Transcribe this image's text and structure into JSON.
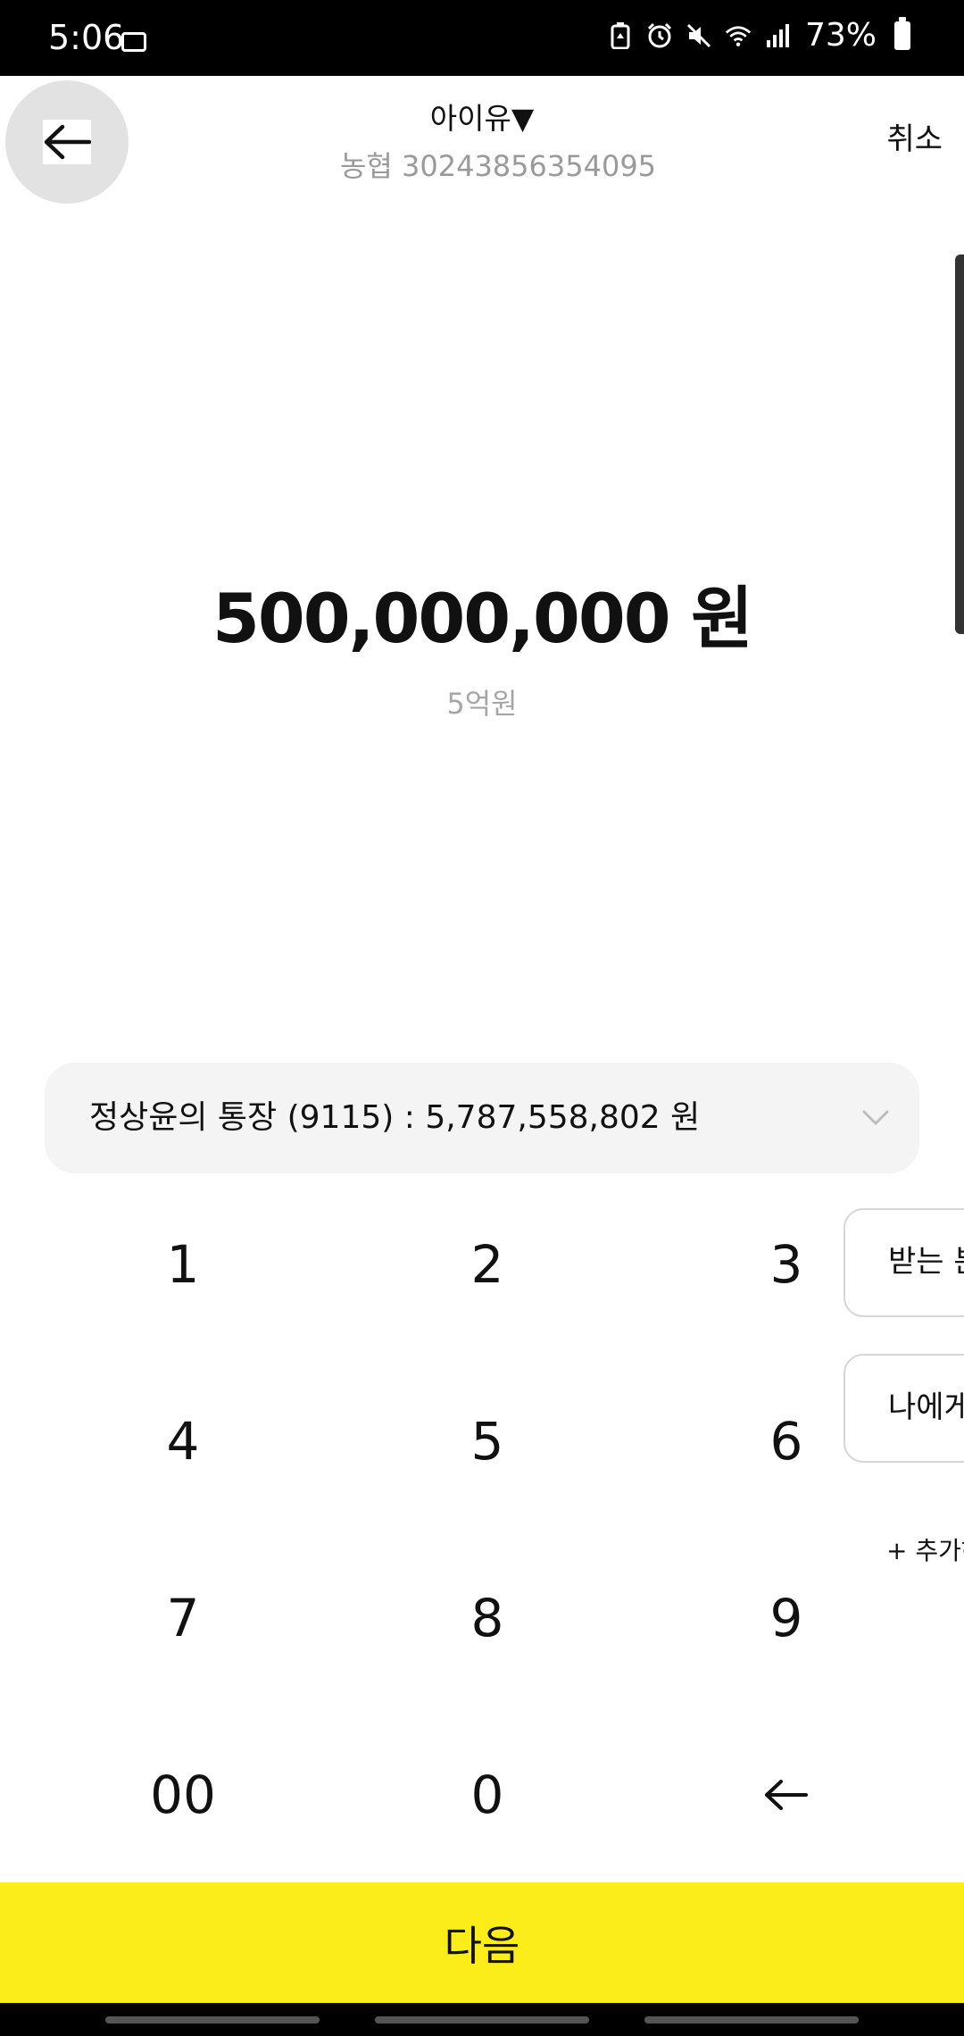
{
  "status_bar": {
    "time": "5:06",
    "battery_percent": "73%",
    "icons": [
      "screen-record-icon",
      "battery-saver-icon",
      "alarm-icon",
      "mute-icon",
      "wifi-icon",
      "signal-icon",
      "battery-icon"
    ]
  },
  "header": {
    "back_icon": "arrow-left-icon",
    "recipient_name": "아이유▼",
    "recipient_account": "농협 30243856354095",
    "cancel_label": "취소"
  },
  "amount": {
    "value": "500,000,000 원",
    "korean": "5억원"
  },
  "source_account": {
    "label": "정상윤의 통장 (9115) :  5,787,558,802 원"
  },
  "keypad": {
    "keys": [
      "1",
      "2",
      "3",
      "4",
      "5",
      "6",
      "7",
      "8",
      "9",
      "00",
      "0"
    ],
    "backspace_icon": "backspace-arrow-icon"
  },
  "side_panel": {
    "chip1": "받는 분",
    "chip2": "나에게",
    "add_label": "+ 추가하기"
  },
  "footer": {
    "next_label": "다음"
  },
  "colors": {
    "accent": "#faed1a",
    "background": "#ffffff",
    "status_bar": "#000000"
  }
}
